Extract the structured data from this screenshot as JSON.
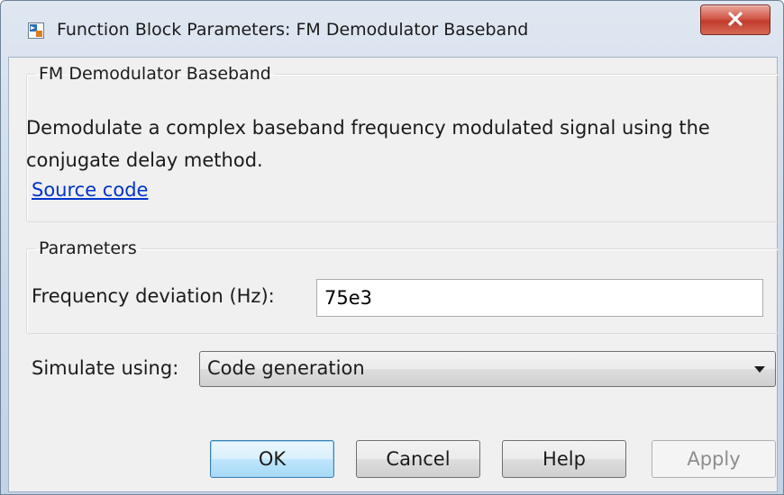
{
  "window": {
    "title": "Function Block Parameters: FM Demodulator Baseband",
    "icon": "simulink-block-icon",
    "close_icon": "close-x-icon"
  },
  "block_group": {
    "legend": "FM Demodulator Baseband",
    "description": "Demodulate a complex baseband frequency modulated signal using the conjugate delay method.",
    "source_link": "Source code"
  },
  "parameters_group": {
    "legend": "Parameters",
    "freq_dev_label": "Frequency deviation (Hz):",
    "freq_dev_value": "75e3"
  },
  "simulate": {
    "label": "Simulate using:",
    "selected": "Code generation"
  },
  "buttons": {
    "ok": "OK",
    "cancel": "Cancel",
    "help": "Help",
    "apply": "Apply"
  },
  "colors": {
    "link": "#0033cc",
    "close_button": "#c9493a",
    "default_button_border": "#3c7fb1"
  }
}
